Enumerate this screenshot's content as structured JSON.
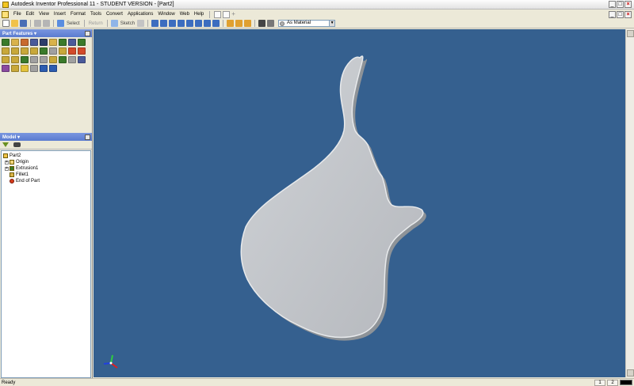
{
  "window": {
    "title": "Autodesk Inventor Professional 11 - STUDENT VERSION - [Part2]",
    "controls": [
      "_",
      "□",
      "×"
    ]
  },
  "menu": {
    "items": [
      "File",
      "Edit",
      "View",
      "Insert",
      "Format",
      "Tools",
      "Convert",
      "Applications",
      "Window",
      "Web",
      "Help"
    ]
  },
  "toolbar": {
    "select_label": "Select",
    "return_label": "Return",
    "sketch_label": "Sketch",
    "material_value": "As Material"
  },
  "features_panel": {
    "title": "Part Features ▾",
    "tool_count_rows": 5
  },
  "model_panel": {
    "title": "Model ▾",
    "tree": [
      {
        "label": "Part2",
        "level": 0
      },
      {
        "label": "Origin",
        "level": 1
      },
      {
        "label": "Extrusion1",
        "level": 1
      },
      {
        "label": "Fillet1",
        "level": 1
      },
      {
        "label": "End of Part",
        "level": 1
      }
    ]
  },
  "statusbar": {
    "text": "Ready",
    "cell_1": "1",
    "cell_2": "2"
  },
  "colors": {
    "viewport_bg": "#35608f",
    "part_fill": "#c3c6ca",
    "panel_header": "#6a89d8"
  }
}
